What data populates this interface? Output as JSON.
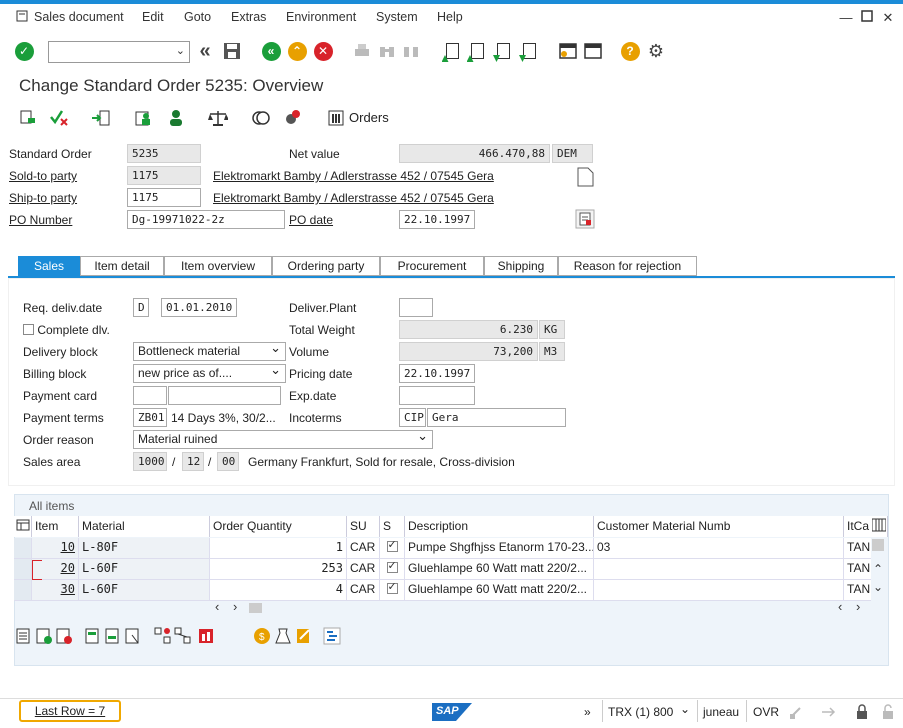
{
  "menu": {
    "items": [
      "Sales document",
      "Edit",
      "Goto",
      "Extras",
      "Environment",
      "System",
      "Help"
    ]
  },
  "window": {
    "title": "Change Standard Order 5235: Overview"
  },
  "apptoolbar": {
    "orders_label": "Orders"
  },
  "header": {
    "standard_order_label": "Standard Order",
    "standard_order": "5235",
    "net_value_label": "Net value",
    "net_value": "466.470,88",
    "currency": "DEM",
    "sold_to_label": "Sold-to party",
    "sold_to": "1175",
    "sold_to_name": "Elektromarkt Bamby / Adlerstrasse 452 / 07545 Gera",
    "ship_to_label": "Ship-to party",
    "ship_to": "1175",
    "ship_to_name": "Elektromarkt Bamby / Adlerstrasse 452 / 07545 Gera",
    "po_number_label": "PO Number",
    "po_number": "Dg-19971022-2z",
    "po_date_label": "PO date",
    "po_date": "22.10.1997"
  },
  "tabs": [
    "Sales",
    "Item detail",
    "Item overview",
    "Ordering party",
    "Procurement",
    "Shipping",
    "Reason for rejection"
  ],
  "sales": {
    "req_deliv_label": "Req. deliv.date",
    "req_deliv_type": "D",
    "req_deliv_date": "01.01.2010",
    "deliver_plant_label": "Deliver.Plant",
    "deliver_plant": "",
    "complete_dlv_label": "Complete dlv.",
    "total_weight_label": "Total Weight",
    "total_weight": "6.230",
    "weight_unit": "KG",
    "delivery_block_label": "Delivery block",
    "delivery_block": "Bottleneck material",
    "volume_label": "Volume",
    "volume": "73,200",
    "volume_unit": "M3",
    "billing_block_label": "Billing block",
    "billing_block": "new price as of....",
    "pricing_date_label": "Pricing date",
    "pricing_date": "22.10.1997",
    "payment_card_label": "Payment card",
    "exp_date_label": "Exp.date",
    "payment_terms_label": "Payment terms",
    "payment_terms": "ZB01",
    "payment_terms_text": "14 Days 3%, 30/2...",
    "incoterms_label": "Incoterms",
    "incoterms": "CIP",
    "incoterms_place": "Gera",
    "order_reason_label": "Order reason",
    "order_reason": "Material ruined",
    "sales_area_label": "Sales area",
    "sales_org": "1000",
    "dist_channel": "12",
    "division": "00",
    "sep": "/",
    "sales_area_text": "Germany Frankfurt, Sold for resale, Cross-division"
  },
  "items": {
    "title": "All items",
    "columns": [
      "Item",
      "Material",
      "Order Quantity",
      "SU",
      "S",
      "Description",
      "Customer Material Numb",
      "ItCa"
    ],
    "rows": [
      {
        "item": "10",
        "material": "L-80F",
        "qty": "1",
        "su": "CAR",
        "desc": "Pumpe Shgfhjss Etanorm 170-23...",
        "cust": "03",
        "itca": "TAN"
      },
      {
        "item": "20",
        "material": "L-60F",
        "qty": "253",
        "su": "CAR",
        "desc": "Gluehlampe 60 Watt matt 220/2...",
        "cust": "",
        "itca": "TAN"
      },
      {
        "item": "30",
        "material": "L-60F",
        "qty": "4",
        "su": "CAR",
        "desc": "Gluehlampe 60 Watt matt 220/2...",
        "cust": "",
        "itca": "TAN"
      }
    ]
  },
  "status": {
    "message": "Last Row = 7",
    "system": "TRX (1) 800",
    "user": "juneau",
    "mode": "OVR",
    "sap": "SAP"
  }
}
